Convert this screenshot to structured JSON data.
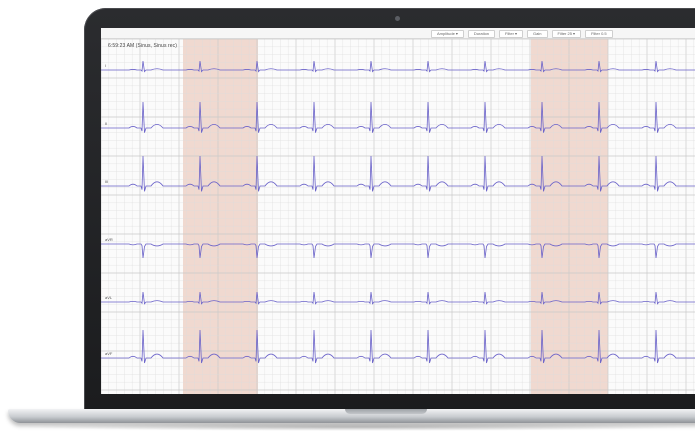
{
  "device": {
    "type": "laptop"
  },
  "app": {
    "toolbar_tabs": [
      {
        "label": "Amplitude ▾"
      },
      {
        "label": "Duration"
      },
      {
        "label": "Filter ▾"
      },
      {
        "label": "Gain"
      },
      {
        "label": "Filter 25 ▾"
      },
      {
        "label": "Filter 0.5"
      }
    ],
    "caption": "6:59:23 AM (Sinus, Sinus rec)",
    "leads": [
      {
        "label": "I"
      },
      {
        "label": "II"
      },
      {
        "label": "III"
      },
      {
        "label": "aVR"
      },
      {
        "label": "aVL"
      },
      {
        "label": "aVF"
      }
    ],
    "highlight_color": "#f0d9d0",
    "trace_color": "#6a62c9",
    "grid_color": "#dcdcdc"
  }
}
